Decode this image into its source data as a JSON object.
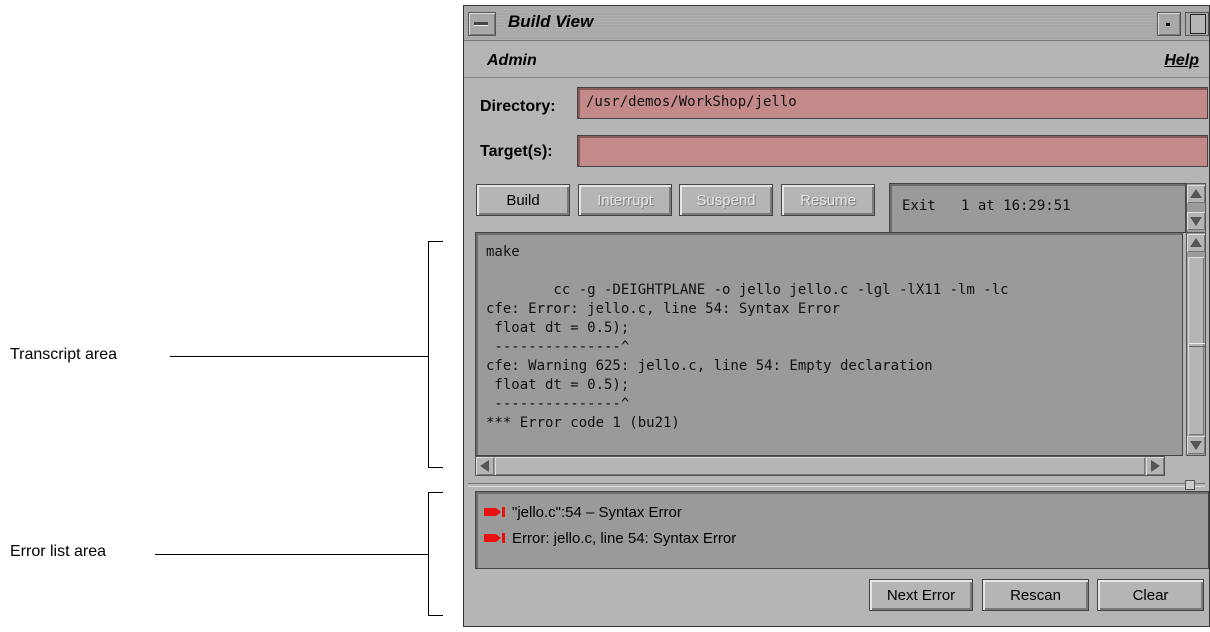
{
  "annotations": {
    "transcript_label": "Transcript area",
    "errorlist_label": "Error list area"
  },
  "window": {
    "title": "Build View"
  },
  "menubar": {
    "admin": "Admin",
    "help": "Help"
  },
  "directory": {
    "label": "Directory:",
    "value": "/usr/demos/WorkShop/jello"
  },
  "targets": {
    "label": "Target(s):",
    "value": ""
  },
  "controls": {
    "build": "Build",
    "interrupt": "Interrupt",
    "suspend": "Suspend",
    "resume": "Resume"
  },
  "status_text": "Exit   1 at 16:29:51",
  "transcript": {
    "lines": [
      "make",
      "",
      "        cc -g -DEIGHTPLANE -o jello jello.c -lgl -lX11 -lm -lc",
      "cfe: Error: jello.c, line 54: Syntax Error",
      " float dt = 0.5);",
      " ---------------^",
      "cfe: Warning 625: jello.c, line 54: Empty declaration",
      " float dt = 0.5);",
      " ---------------^",
      "*** Error code 1 (bu21)"
    ]
  },
  "errors": [
    {
      "text": "\"jello.c\":54 – Syntax Error",
      "icon": "error-arrow-icon",
      "color": "#e81010"
    },
    {
      "text": "Error: jello.c, line 54: Syntax Error",
      "icon": "error-arrow-icon",
      "color": "#e81010"
    }
  ],
  "footer": {
    "next_error": "Next Error",
    "rescan": "Rescan",
    "clear": "Clear"
  }
}
